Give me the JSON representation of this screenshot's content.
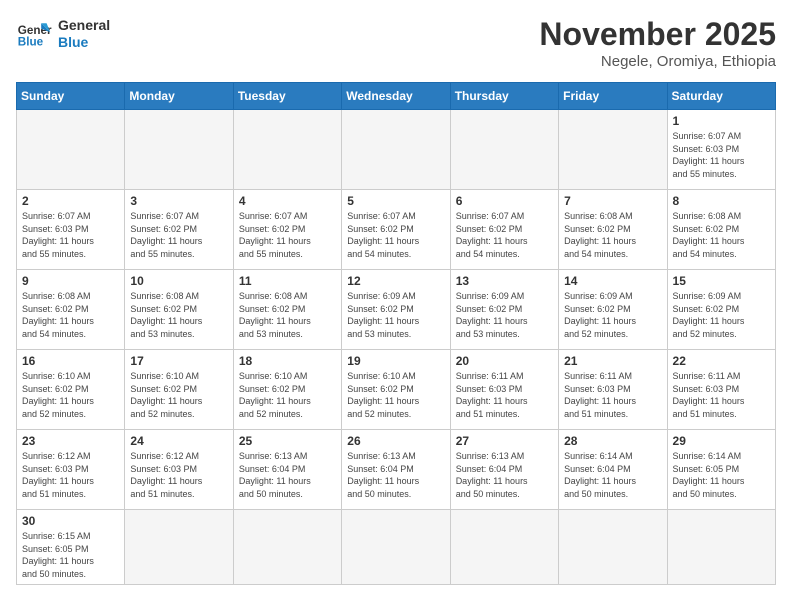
{
  "logo": {
    "text_general": "General",
    "text_blue": "Blue"
  },
  "header": {
    "month": "November 2025",
    "location": "Negele, Oromiya, Ethiopia"
  },
  "weekdays": [
    "Sunday",
    "Monday",
    "Tuesday",
    "Wednesday",
    "Thursday",
    "Friday",
    "Saturday"
  ],
  "weeks": [
    [
      {
        "day": "",
        "info": ""
      },
      {
        "day": "",
        "info": ""
      },
      {
        "day": "",
        "info": ""
      },
      {
        "day": "",
        "info": ""
      },
      {
        "day": "",
        "info": ""
      },
      {
        "day": "",
        "info": ""
      },
      {
        "day": "1",
        "info": "Sunrise: 6:07 AM\nSunset: 6:03 PM\nDaylight: 11 hours\nand 55 minutes."
      }
    ],
    [
      {
        "day": "2",
        "info": "Sunrise: 6:07 AM\nSunset: 6:03 PM\nDaylight: 11 hours\nand 55 minutes."
      },
      {
        "day": "3",
        "info": "Sunrise: 6:07 AM\nSunset: 6:02 PM\nDaylight: 11 hours\nand 55 minutes."
      },
      {
        "day": "4",
        "info": "Sunrise: 6:07 AM\nSunset: 6:02 PM\nDaylight: 11 hours\nand 55 minutes."
      },
      {
        "day": "5",
        "info": "Sunrise: 6:07 AM\nSunset: 6:02 PM\nDaylight: 11 hours\nand 54 minutes."
      },
      {
        "day": "6",
        "info": "Sunrise: 6:07 AM\nSunset: 6:02 PM\nDaylight: 11 hours\nand 54 minutes."
      },
      {
        "day": "7",
        "info": "Sunrise: 6:08 AM\nSunset: 6:02 PM\nDaylight: 11 hours\nand 54 minutes."
      },
      {
        "day": "8",
        "info": "Sunrise: 6:08 AM\nSunset: 6:02 PM\nDaylight: 11 hours\nand 54 minutes."
      }
    ],
    [
      {
        "day": "9",
        "info": "Sunrise: 6:08 AM\nSunset: 6:02 PM\nDaylight: 11 hours\nand 54 minutes."
      },
      {
        "day": "10",
        "info": "Sunrise: 6:08 AM\nSunset: 6:02 PM\nDaylight: 11 hours\nand 53 minutes."
      },
      {
        "day": "11",
        "info": "Sunrise: 6:08 AM\nSunset: 6:02 PM\nDaylight: 11 hours\nand 53 minutes."
      },
      {
        "day": "12",
        "info": "Sunrise: 6:09 AM\nSunset: 6:02 PM\nDaylight: 11 hours\nand 53 minutes."
      },
      {
        "day": "13",
        "info": "Sunrise: 6:09 AM\nSunset: 6:02 PM\nDaylight: 11 hours\nand 53 minutes."
      },
      {
        "day": "14",
        "info": "Sunrise: 6:09 AM\nSunset: 6:02 PM\nDaylight: 11 hours\nand 52 minutes."
      },
      {
        "day": "15",
        "info": "Sunrise: 6:09 AM\nSunset: 6:02 PM\nDaylight: 11 hours\nand 52 minutes."
      }
    ],
    [
      {
        "day": "16",
        "info": "Sunrise: 6:10 AM\nSunset: 6:02 PM\nDaylight: 11 hours\nand 52 minutes."
      },
      {
        "day": "17",
        "info": "Sunrise: 6:10 AM\nSunset: 6:02 PM\nDaylight: 11 hours\nand 52 minutes."
      },
      {
        "day": "18",
        "info": "Sunrise: 6:10 AM\nSunset: 6:02 PM\nDaylight: 11 hours\nand 52 minutes."
      },
      {
        "day": "19",
        "info": "Sunrise: 6:10 AM\nSunset: 6:02 PM\nDaylight: 11 hours\nand 52 minutes."
      },
      {
        "day": "20",
        "info": "Sunrise: 6:11 AM\nSunset: 6:03 PM\nDaylight: 11 hours\nand 51 minutes."
      },
      {
        "day": "21",
        "info": "Sunrise: 6:11 AM\nSunset: 6:03 PM\nDaylight: 11 hours\nand 51 minutes."
      },
      {
        "day": "22",
        "info": "Sunrise: 6:11 AM\nSunset: 6:03 PM\nDaylight: 11 hours\nand 51 minutes."
      }
    ],
    [
      {
        "day": "23",
        "info": "Sunrise: 6:12 AM\nSunset: 6:03 PM\nDaylight: 11 hours\nand 51 minutes."
      },
      {
        "day": "24",
        "info": "Sunrise: 6:12 AM\nSunset: 6:03 PM\nDaylight: 11 hours\nand 51 minutes."
      },
      {
        "day": "25",
        "info": "Sunrise: 6:13 AM\nSunset: 6:04 PM\nDaylight: 11 hours\nand 50 minutes."
      },
      {
        "day": "26",
        "info": "Sunrise: 6:13 AM\nSunset: 6:04 PM\nDaylight: 11 hours\nand 50 minutes."
      },
      {
        "day": "27",
        "info": "Sunrise: 6:13 AM\nSunset: 6:04 PM\nDaylight: 11 hours\nand 50 minutes."
      },
      {
        "day": "28",
        "info": "Sunrise: 6:14 AM\nSunset: 6:04 PM\nDaylight: 11 hours\nand 50 minutes."
      },
      {
        "day": "29",
        "info": "Sunrise: 6:14 AM\nSunset: 6:05 PM\nDaylight: 11 hours\nand 50 minutes."
      }
    ],
    [
      {
        "day": "30",
        "info": "Sunrise: 6:15 AM\nSunset: 6:05 PM\nDaylight: 11 hours\nand 50 minutes."
      },
      {
        "day": "",
        "info": ""
      },
      {
        "day": "",
        "info": ""
      },
      {
        "day": "",
        "info": ""
      },
      {
        "day": "",
        "info": ""
      },
      {
        "day": "",
        "info": ""
      },
      {
        "day": "",
        "info": ""
      }
    ]
  ]
}
